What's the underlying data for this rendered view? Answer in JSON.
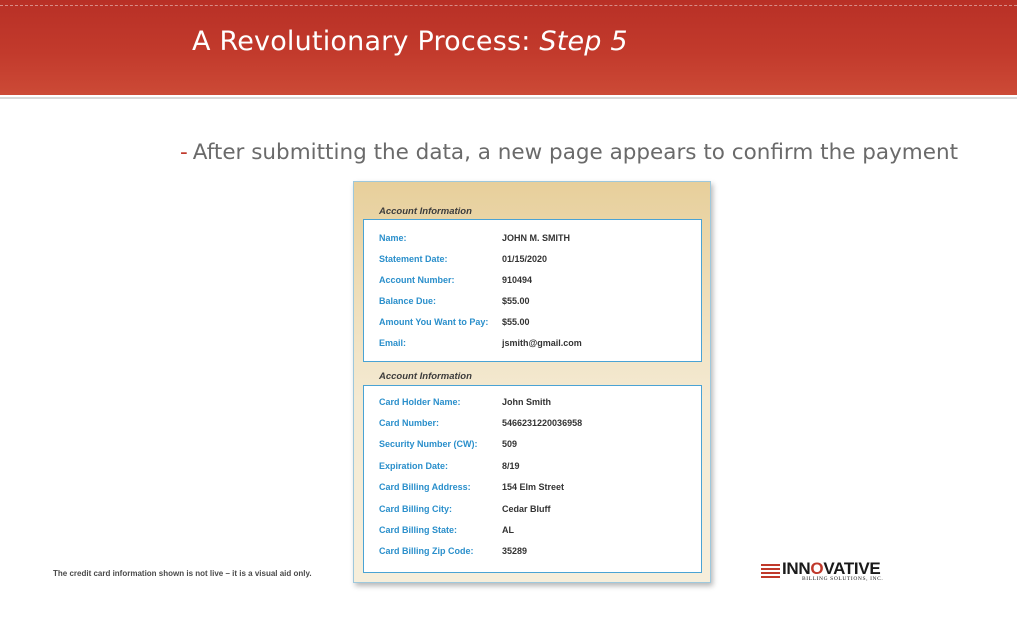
{
  "slide": {
    "title_main": "A Revolutionary Process: ",
    "title_italic": "Step 5",
    "bullet_dash": "-",
    "bullet_text": "After submitting the data, a new page appears to confirm the payment",
    "footnote": "The credit card information shown is not live – it is a visual aid only."
  },
  "account_section": {
    "title": "Account Information",
    "rows": [
      {
        "label": "Name:",
        "value": "JOHN M. SMITH"
      },
      {
        "label": "Statement Date:",
        "value": "01/15/2020"
      },
      {
        "label": "Account Number:",
        "value": "910494"
      },
      {
        "label": "Balance Due:",
        "value": "$55.00"
      },
      {
        "label": "Amount You Want to Pay:",
        "value": "$55.00"
      },
      {
        "label": "Email:",
        "value": "jsmith@gmail.com"
      }
    ]
  },
  "card_section": {
    "title": "Account Information",
    "rows": [
      {
        "label": "Card Holder Name:",
        "value": "John Smith"
      },
      {
        "label": "Card Number:",
        "value": "5466231220036958"
      },
      {
        "label": "Security Number (CW):",
        "value": "509"
      },
      {
        "label": "Expiration Date:",
        "value": "8/19"
      },
      {
        "label": "Card Billing Address:",
        "value": "154 Elm Street"
      },
      {
        "label": "Card Billing City:",
        "value": "Cedar Bluff"
      },
      {
        "label": "Card Billing State:",
        "value": "AL"
      },
      {
        "label": "Card Billing Zip Code:",
        "value": "35289"
      }
    ]
  },
  "logo": {
    "name_pre": "INN",
    "name_o": "O",
    "name_post": "VATIVE",
    "tagline": "BILLING SOLUTIONS, INC."
  },
  "colors": {
    "header": "#c23a2c",
    "label_blue": "#2a8fcb",
    "box_border": "#4aa3d4",
    "accent_red": "#c0392b"
  }
}
